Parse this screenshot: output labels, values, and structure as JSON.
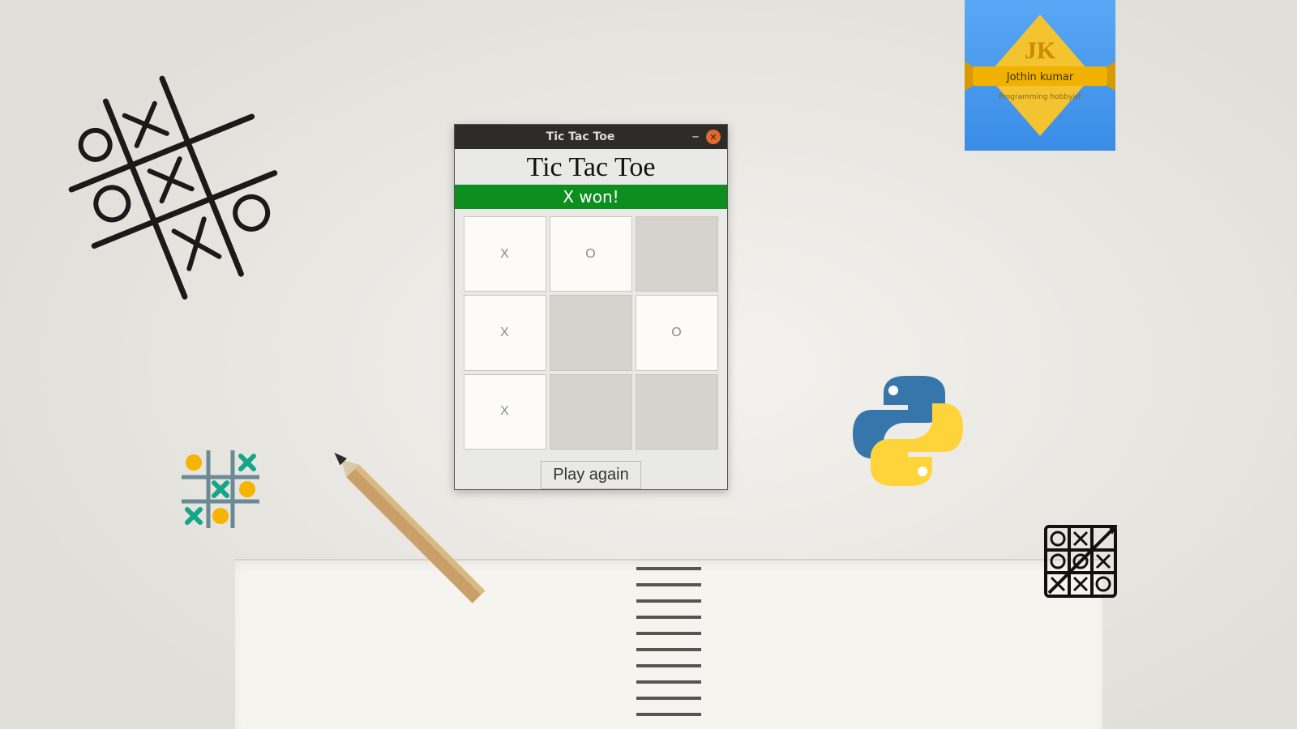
{
  "window": {
    "titlebar_title": "Tic Tac Toe",
    "heading": "Tic Tac Toe",
    "status": "X won!",
    "play_again_label": "Play again",
    "board": [
      {
        "mark": "X",
        "used": true
      },
      {
        "mark": "O",
        "used": true
      },
      {
        "mark": "",
        "used": false
      },
      {
        "mark": "X",
        "used": true
      },
      {
        "mark": "",
        "used": false
      },
      {
        "mark": "O",
        "used": true
      },
      {
        "mark": "X",
        "used": true
      },
      {
        "mark": "",
        "used": false
      },
      {
        "mark": "",
        "used": false
      }
    ]
  },
  "badge": {
    "initials": "JK",
    "name": "Jothin kumar",
    "subtitle": "Programming hobbyist"
  },
  "icons": {
    "minimize": "minimize-icon",
    "close": "close-icon",
    "python": "python-logo-icon",
    "sketch_board": "tic-tac-toe-sketch-icon",
    "mini_board": "mini-tic-tac-toe-icon",
    "line_board": "tic-tac-toe-line-icon",
    "pencil": "pencil-icon",
    "notebook": "notebook-icon"
  },
  "colors": {
    "status_bg": "#0c8f1f",
    "badge_bg": "#3a8ce6",
    "accent_yellow": "#f4c430",
    "python_blue": "#3776ab",
    "python_yellow": "#ffd43b"
  }
}
